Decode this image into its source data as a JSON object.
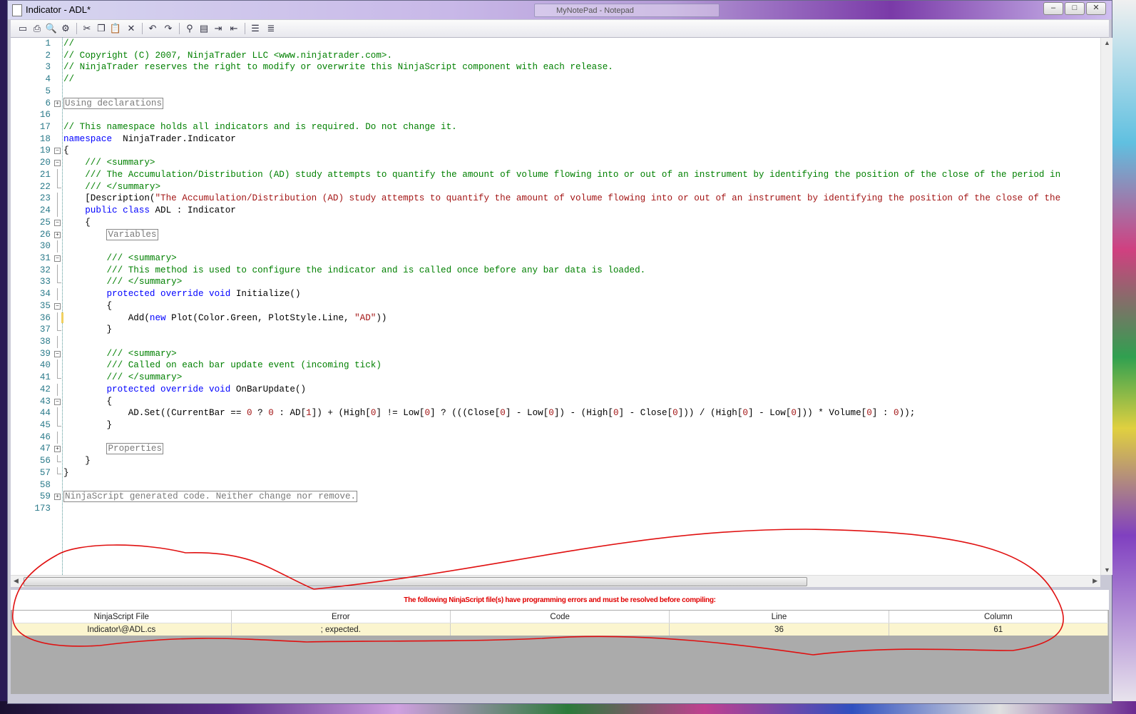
{
  "window": {
    "title": "Indicator - ADL*",
    "background_window_title": "MyNotePad - Notepad",
    "controls": {
      "minimize": "–",
      "maximize": "□",
      "close": "✕"
    }
  },
  "toolbar": {
    "items": [
      "save-icon",
      "print-icon",
      "print-preview-icon",
      "compile-icon",
      "cut-icon",
      "copy-icon",
      "paste-icon",
      "delete-icon",
      "undo-icon",
      "redo-icon",
      "find-icon",
      "find-replace-icon",
      "indent-icon",
      "outdent-icon",
      "comment-icon",
      "uncomment-icon"
    ]
  },
  "editor": {
    "lines": [
      {
        "n": "1",
        "fold": "",
        "t": [
          [
            "cm",
            "//"
          ]
        ]
      },
      {
        "n": "2",
        "fold": "",
        "t": [
          [
            "cm",
            "// Copyright (C) 2007, NinjaTrader LLC <www.ninjatrader.com>."
          ]
        ]
      },
      {
        "n": "3",
        "fold": "",
        "t": [
          [
            "cm",
            "// NinjaTrader reserves the right to modify or overwrite this NinjaScript component with each release."
          ]
        ]
      },
      {
        "n": "4",
        "fold": "",
        "t": [
          [
            "cm",
            "//"
          ]
        ]
      },
      {
        "n": "5",
        "fold": "",
        "t": []
      },
      {
        "n": "6",
        "fold": "+",
        "t": [
          [
            "region",
            "Using declarations"
          ]
        ]
      },
      {
        "n": "16",
        "fold": "",
        "t": []
      },
      {
        "n": "17",
        "fold": "",
        "t": [
          [
            "cm",
            "// This namespace holds all indicators and is required. Do not change it."
          ]
        ]
      },
      {
        "n": "18",
        "fold": "",
        "t": [
          [
            "kw",
            "namespace"
          ],
          [
            "",
            "  NinjaTrader.Indicator"
          ]
        ]
      },
      {
        "n": "19",
        "fold": "-",
        "t": [
          [
            "",
            "{"
          ]
        ]
      },
      {
        "n": "20",
        "fold": "-",
        "t": [
          [
            "",
            "    "
          ],
          [
            "cm",
            "/// <summary>"
          ]
        ]
      },
      {
        "n": "21",
        "fold": "|",
        "t": [
          [
            "",
            "    "
          ],
          [
            "cm",
            "/// The Accumulation/Distribution (AD) study attempts to quantify the amount of volume flowing into or out of an instrument by identifying the position of the close of the period in"
          ]
        ]
      },
      {
        "n": "22",
        "fold": "L",
        "t": [
          [
            "",
            "    "
          ],
          [
            "cm",
            "/// </summary>"
          ]
        ]
      },
      {
        "n": "23",
        "fold": "|",
        "t": [
          [
            "",
            "    [Description("
          ],
          [
            "st",
            "\"The Accumulation/Distribution (AD) study attempts to quantify the amount of volume flowing into or out of an instrument by identifying the position of the close of the"
          ]
        ]
      },
      {
        "n": "24",
        "fold": "|",
        "t": [
          [
            "",
            "    "
          ],
          [
            "kw",
            "public class"
          ],
          [
            "",
            " ADL : Indicator"
          ]
        ]
      },
      {
        "n": "25",
        "fold": "-",
        "t": [
          [
            "",
            "    {"
          ]
        ]
      },
      {
        "n": "26",
        "fold": "+",
        "t": [
          [
            "",
            "        "
          ],
          [
            "region",
            "Variables"
          ]
        ]
      },
      {
        "n": "30",
        "fold": "|",
        "t": []
      },
      {
        "n": "31",
        "fold": "-",
        "t": [
          [
            "",
            "        "
          ],
          [
            "cm",
            "/// <summary>"
          ]
        ]
      },
      {
        "n": "32",
        "fold": "|",
        "t": [
          [
            "",
            "        "
          ],
          [
            "cm",
            "/// This method is used to configure the indicator and is called once before any bar data is loaded."
          ]
        ]
      },
      {
        "n": "33",
        "fold": "L",
        "t": [
          [
            "",
            "        "
          ],
          [
            "cm",
            "/// </summary>"
          ]
        ]
      },
      {
        "n": "34",
        "fold": "|",
        "t": [
          [
            "",
            "        "
          ],
          [
            "kw",
            "protected override void"
          ],
          [
            "",
            " Initialize()"
          ]
        ]
      },
      {
        "n": "35",
        "fold": "-",
        "t": [
          [
            "",
            "        {"
          ]
        ]
      },
      {
        "n": "36",
        "fold": "|",
        "t": [
          [
            "",
            "            Add("
          ],
          [
            "kw",
            "new"
          ],
          [
            "",
            " Plot(Color.Green, PlotStyle.Line, "
          ],
          [
            "st",
            "\"AD\""
          ],
          [
            "",
            "))"
          ]
        ]
      },
      {
        "n": "37",
        "fold": "L",
        "t": [
          [
            "",
            "        }"
          ]
        ]
      },
      {
        "n": "38",
        "fold": "|",
        "t": []
      },
      {
        "n": "39",
        "fold": "-",
        "t": [
          [
            "",
            "        "
          ],
          [
            "cm",
            "/// <summary>"
          ]
        ]
      },
      {
        "n": "40",
        "fold": "|",
        "t": [
          [
            "",
            "        "
          ],
          [
            "cm",
            "/// Called on each bar update event (incoming tick)"
          ]
        ]
      },
      {
        "n": "41",
        "fold": "L",
        "t": [
          [
            "",
            "        "
          ],
          [
            "cm",
            "/// </summary>"
          ]
        ]
      },
      {
        "n": "42",
        "fold": "|",
        "t": [
          [
            "",
            "        "
          ],
          [
            "kw",
            "protected override void"
          ],
          [
            "",
            " OnBarUpdate()"
          ]
        ]
      },
      {
        "n": "43",
        "fold": "-",
        "t": [
          [
            "",
            "        {"
          ]
        ]
      },
      {
        "n": "44",
        "fold": "|",
        "t": [
          [
            "",
            "            AD.Set((CurrentBar == "
          ],
          [
            "num",
            "0"
          ],
          [
            "",
            " ? "
          ],
          [
            "num",
            "0"
          ],
          [
            "",
            " : AD["
          ],
          [
            "num",
            "1"
          ],
          [
            "",
            "]) + (High["
          ],
          [
            "num",
            "0"
          ],
          [
            "",
            "] != Low["
          ],
          [
            "num",
            "0"
          ],
          [
            "",
            "] ? (((Close["
          ],
          [
            "num",
            "0"
          ],
          [
            "",
            "] - Low["
          ],
          [
            "num",
            "0"
          ],
          [
            "",
            "]) - (High["
          ],
          [
            "num",
            "0"
          ],
          [
            "",
            "] - Close["
          ],
          [
            "num",
            "0"
          ],
          [
            "",
            "])) / (High["
          ],
          [
            "num",
            "0"
          ],
          [
            "",
            "] - Low["
          ],
          [
            "num",
            "0"
          ],
          [
            "",
            "])) * Volume["
          ],
          [
            "num",
            "0"
          ],
          [
            "",
            "] : "
          ],
          [
            "num",
            "0"
          ],
          [
            "",
            "));"
          ]
        ]
      },
      {
        "n": "45",
        "fold": "L",
        "t": [
          [
            "",
            "        }"
          ]
        ]
      },
      {
        "n": "46",
        "fold": "|",
        "t": []
      },
      {
        "n": "47",
        "fold": "+",
        "t": [
          [
            "",
            "        "
          ],
          [
            "region",
            "Properties"
          ]
        ]
      },
      {
        "n": "56",
        "fold": "L",
        "t": [
          [
            "",
            "    }"
          ]
        ]
      },
      {
        "n": "57",
        "fold": "L",
        "t": [
          [
            "",
            "}"
          ]
        ]
      },
      {
        "n": "58",
        "fold": "",
        "t": []
      },
      {
        "n": "59",
        "fold": "+",
        "t": [
          [
            "region",
            "NinjaScript generated code. Neither change nor remove."
          ]
        ]
      },
      {
        "n": "173",
        "fold": "",
        "t": []
      }
    ]
  },
  "errors": {
    "header": "The following NinjaScript file(s) have programming errors and must be resolved before compiling:",
    "columns": [
      "NinjaScript File",
      "Error",
      "Code",
      "Line",
      "Column"
    ],
    "rows": [
      [
        "Indicator\\@ADL.cs",
        "; expected.",
        "",
        "36",
        "61"
      ]
    ]
  },
  "colors": {
    "comment": "#008000",
    "keyword": "#0000ff",
    "string": "#a31515",
    "error_text": "#e00000",
    "annotation": "#e00000"
  }
}
